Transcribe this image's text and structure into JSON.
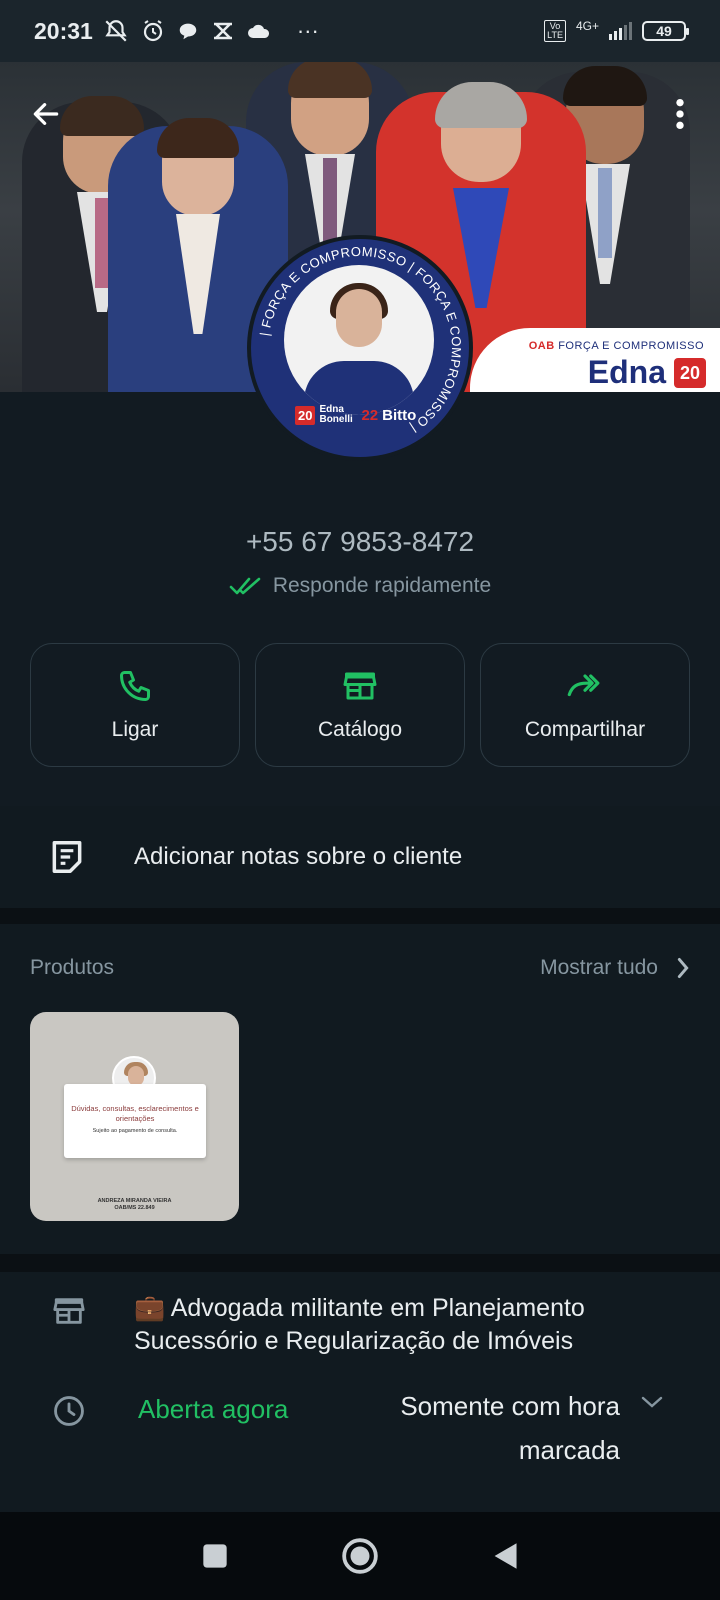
{
  "status_bar": {
    "time": "20:31",
    "overflow_dots": "···",
    "network_label": "4G+",
    "volte_label": "Vo\nLTE",
    "battery_level": "49"
  },
  "cover": {
    "logo_prefix": "OAB",
    "logo_tagline": "FORÇA E COMPROMISSO",
    "logo_name": "Edna",
    "logo_number": "20"
  },
  "avatar": {
    "ring_text": "| FORÇA E COMPROMISSO | FORÇA E COMPROMISSO |",
    "badge_number_1": "20",
    "badge_name_1": "Edna Bonelli",
    "badge_number_2": "22",
    "badge_name_2": "Bitto"
  },
  "profile": {
    "phone": "+55 67 9853-8472",
    "response_status": "Responde rapidamente"
  },
  "actions": [
    {
      "label": "Ligar",
      "icon": "phone-icon"
    },
    {
      "label": "Catálogo",
      "icon": "storefront-icon"
    },
    {
      "label": "Compartilhar",
      "icon": "share-forward-icon"
    }
  ],
  "notes": {
    "label": "Adicionar notas sobre o cliente"
  },
  "produtos": {
    "title": "Produtos",
    "show_all": "Mostrar tudo",
    "product": {
      "headline": "Dúvidas, consultas, esclarecimentos e orientações",
      "subline": "Sujeito ao pagamento de consulta.",
      "footer_name": "ANDREZA MIRANDA VIEIRA",
      "footer_oab": "OAB/MS 22.849"
    }
  },
  "business_info": {
    "description": "💼 Advogada militante em Planejamento Sucessório e Regularização de Imóveis",
    "open_status": "Aberta agora",
    "hours": "Somente com hora marcada"
  },
  "colors": {
    "background": "#121b22",
    "accent_green": "#21c063",
    "muted_text": "#8696a0",
    "card_border": "#2c3a43"
  }
}
